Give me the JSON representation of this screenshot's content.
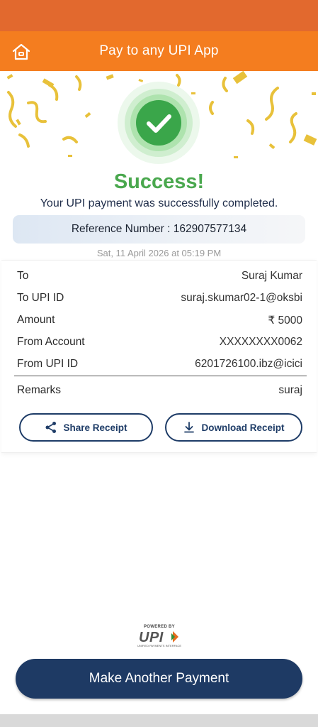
{
  "header": {
    "title": "Pay to any UPI App",
    "home_icon": "home-icon"
  },
  "status": {
    "title": "Success!",
    "message": "Your UPI payment was successfully completed.",
    "reference": "Reference Number : 162907577134",
    "timestamp": "Sat, 11 April 2026 at 05:19 PM"
  },
  "details": [
    {
      "label": "To",
      "value": "Suraj Kumar"
    },
    {
      "label": "To UPI ID",
      "value": "suraj.skumar02-1@oksbi"
    },
    {
      "label": "Amount",
      "value": "₹ 5000"
    },
    {
      "label": "From Account",
      "value": "XXXXXXXX0062"
    },
    {
      "label": "From UPI ID",
      "value": "6201726100.ibz@icici"
    },
    {
      "label": "Remarks",
      "value": "suraj"
    }
  ],
  "actions": {
    "share_label": "Share Receipt",
    "download_label": "Download Receipt"
  },
  "upi_logo": {
    "powered_by": "POWERED BY",
    "word": "UPI",
    "tagline": "UNIFIED PAYMENTS INTERFACE"
  },
  "primary_button": "Make Another Payment",
  "colors": {
    "header": "#f47d1f",
    "status_bar": "#e2692e",
    "success": "#4aa84e",
    "primary": "#1e3a64"
  }
}
